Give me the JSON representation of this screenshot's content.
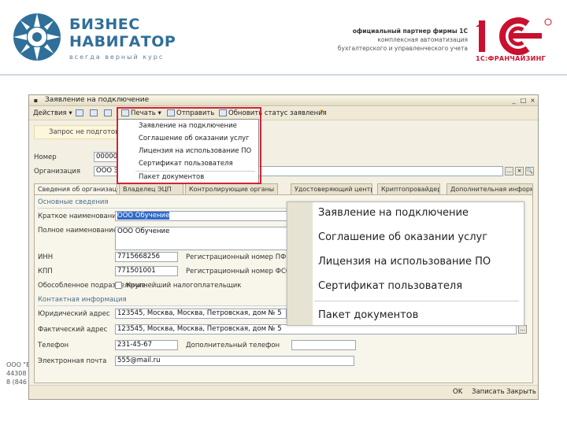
{
  "banner": {
    "logo_line1": "БИЗНЕС",
    "logo_line2": "НАВИГАТОР",
    "logo_slogan": "всегда верный курс",
    "partner_line1": "официальный партнер фирмы 1С",
    "partner_line2": "комплексная автоматизация",
    "partner_line3": "бухгалтерского и управленческого учета",
    "franchise": "1С:ФРАНЧАЙЗИНГ"
  },
  "footer": {
    "line1": "ООО \"Б",
    "line2": "44308",
    "line3": "8 (846"
  },
  "window": {
    "title": "Заявление на подключение",
    "toolbar": {
      "actions": "Действия ▾",
      "print": "Печать ▾",
      "send": "Отправить",
      "update_status": "Обновить статус заявления",
      "help": "?"
    },
    "info_line": "Запрос не подготовлен",
    "number_label": "Номер",
    "number_value": "000000",
    "org_label": "Организация",
    "org_value": "ООО Эл",
    "tabs": [
      "Сведения об организации",
      "Владелец ЭЦП",
      "Контролирующие органы",
      "Удостоверяющий центр",
      "Криптопровайдер",
      "Дополнительная информация"
    ],
    "basic_section": "Основные сведения",
    "short_name_label": "Краткое наименование",
    "short_name_value": "ООО Обучение",
    "full_name_label": "Полное наименование",
    "full_name_value": "ООО Обучение",
    "inn_label": "ИНН",
    "inn_value": "7715668256",
    "reg_pfr_label": "Регистрационный номер ПФР",
    "kpp_label": "КПП",
    "kpp_value": "771501001",
    "reg_fss_label": "Регистрационный номер ФСС",
    "separate_label": "Обособленное подразделение",
    "largest_label": "Крупнейший налогоплательщик",
    "contacts_section": "Контактная информация",
    "legal_addr_label": "Юридический адрес",
    "legal_addr_value": "123545, Москва, Москва, Петровская, дом № 5",
    "actual_addr_label": "Фактический адрес",
    "actual_addr_value": "123545, Москва, Москва, Петровская, дом № 5",
    "phone_label": "Телефон",
    "phone_value": "231-45-67",
    "extra_phone_label": "Дополнительный телефон",
    "email_label": "Электронная почта",
    "email_value": "555@mail.ru",
    "status": {
      "ok": "OK",
      "save": "Записать",
      "close": "Закрыть"
    }
  },
  "print_menu": {
    "items": [
      "Заявление на подключение",
      "Соглашение об оказании услуг",
      "Лицензия на использование ПО",
      "Сертификат пользователя",
      "Пакет документов"
    ]
  },
  "colors": {
    "brand_blue": "#2f6f99",
    "brand_red": "#c9102f",
    "highlight_frame": "#d0243a",
    "selection": "#3169c6"
  }
}
